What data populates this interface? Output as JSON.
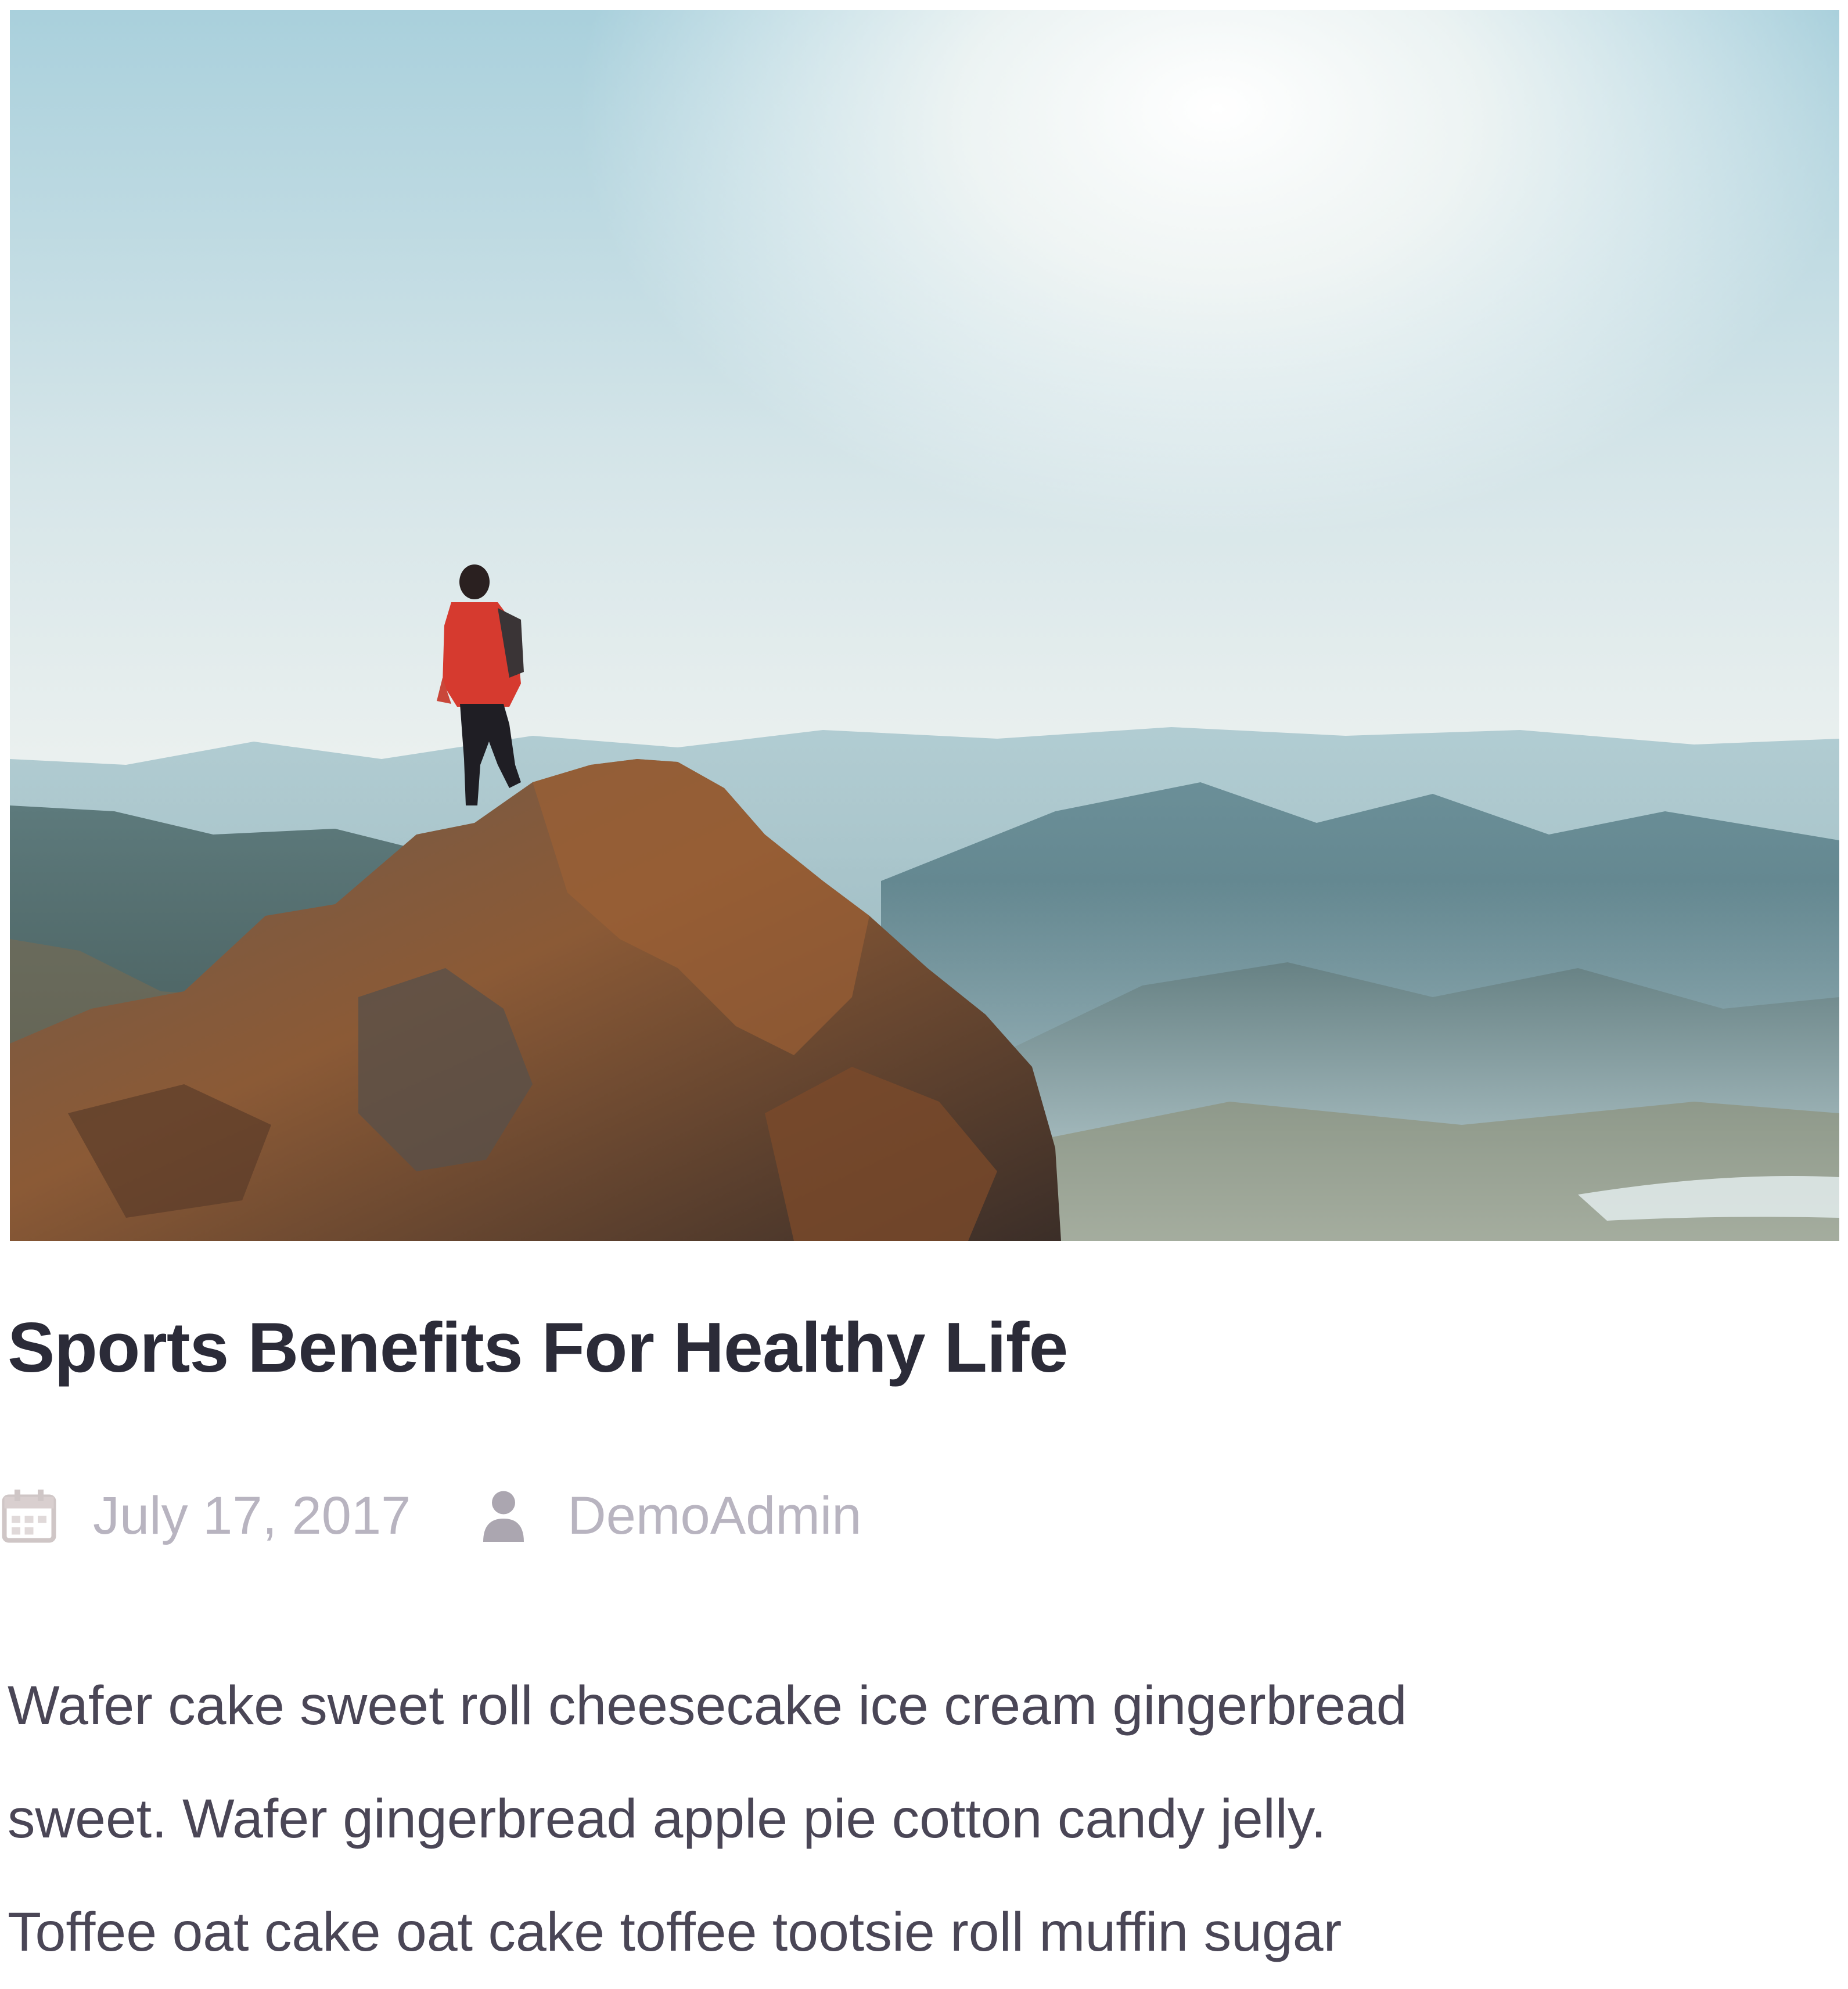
{
  "post": {
    "image_alt": "Hiker standing on a rocky mountain peak",
    "title": "Sports Benefits For Healthy Life",
    "meta": {
      "date": "July 17, 2017",
      "date_icon": "calendar-icon",
      "author": "DemoAdmin",
      "author_icon": "user-icon"
    },
    "excerpt_lines": [
      "Wafer cake sweet roll cheesecake ice cream gingerbread",
      "sweet. Wafer gingerbread apple pie cotton candy jelly.",
      "Toffee oat cake oat cake toffee tootsie roll muffin sugar"
    ]
  },
  "colors": {
    "title": "#2b2b38",
    "meta": "#b8b4c0",
    "excerpt": "#4a4656"
  }
}
